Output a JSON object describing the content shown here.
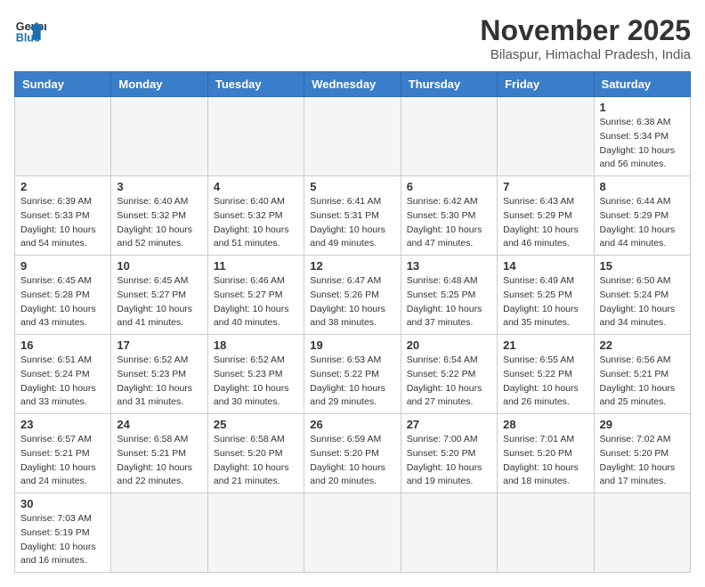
{
  "header": {
    "logo_line1": "General",
    "logo_line2": "Blue",
    "month": "November 2025",
    "location": "Bilaspur, Himachal Pradesh, India"
  },
  "weekdays": [
    "Sunday",
    "Monday",
    "Tuesday",
    "Wednesday",
    "Thursday",
    "Friday",
    "Saturday"
  ],
  "weeks": [
    [
      null,
      null,
      null,
      null,
      null,
      null,
      {
        "day": 1,
        "sunrise": "6:38 AM",
        "sunset": "5:34 PM",
        "daylight": "10 hours and 56 minutes."
      }
    ],
    [
      {
        "day": 2,
        "sunrise": "6:39 AM",
        "sunset": "5:33 PM",
        "daylight": "10 hours and 54 minutes."
      },
      {
        "day": 3,
        "sunrise": "6:40 AM",
        "sunset": "5:32 PM",
        "daylight": "10 hours and 52 minutes."
      },
      {
        "day": 4,
        "sunrise": "6:40 AM",
        "sunset": "5:32 PM",
        "daylight": "10 hours and 51 minutes."
      },
      {
        "day": 5,
        "sunrise": "6:41 AM",
        "sunset": "5:31 PM",
        "daylight": "10 hours and 49 minutes."
      },
      {
        "day": 6,
        "sunrise": "6:42 AM",
        "sunset": "5:30 PM",
        "daylight": "10 hours and 47 minutes."
      },
      {
        "day": 7,
        "sunrise": "6:43 AM",
        "sunset": "5:29 PM",
        "daylight": "10 hours and 46 minutes."
      },
      {
        "day": 8,
        "sunrise": "6:44 AM",
        "sunset": "5:29 PM",
        "daylight": "10 hours and 44 minutes."
      }
    ],
    [
      {
        "day": 9,
        "sunrise": "6:45 AM",
        "sunset": "5:28 PM",
        "daylight": "10 hours and 43 minutes."
      },
      {
        "day": 10,
        "sunrise": "6:45 AM",
        "sunset": "5:27 PM",
        "daylight": "10 hours and 41 minutes."
      },
      {
        "day": 11,
        "sunrise": "6:46 AM",
        "sunset": "5:27 PM",
        "daylight": "10 hours and 40 minutes."
      },
      {
        "day": 12,
        "sunrise": "6:47 AM",
        "sunset": "5:26 PM",
        "daylight": "10 hours and 38 minutes."
      },
      {
        "day": 13,
        "sunrise": "6:48 AM",
        "sunset": "5:25 PM",
        "daylight": "10 hours and 37 minutes."
      },
      {
        "day": 14,
        "sunrise": "6:49 AM",
        "sunset": "5:25 PM",
        "daylight": "10 hours and 35 minutes."
      },
      {
        "day": 15,
        "sunrise": "6:50 AM",
        "sunset": "5:24 PM",
        "daylight": "10 hours and 34 minutes."
      }
    ],
    [
      {
        "day": 16,
        "sunrise": "6:51 AM",
        "sunset": "5:24 PM",
        "daylight": "10 hours and 33 minutes."
      },
      {
        "day": 17,
        "sunrise": "6:52 AM",
        "sunset": "5:23 PM",
        "daylight": "10 hours and 31 minutes."
      },
      {
        "day": 18,
        "sunrise": "6:52 AM",
        "sunset": "5:23 PM",
        "daylight": "10 hours and 30 minutes."
      },
      {
        "day": 19,
        "sunrise": "6:53 AM",
        "sunset": "5:22 PM",
        "daylight": "10 hours and 29 minutes."
      },
      {
        "day": 20,
        "sunrise": "6:54 AM",
        "sunset": "5:22 PM",
        "daylight": "10 hours and 27 minutes."
      },
      {
        "day": 21,
        "sunrise": "6:55 AM",
        "sunset": "5:22 PM",
        "daylight": "10 hours and 26 minutes."
      },
      {
        "day": 22,
        "sunrise": "6:56 AM",
        "sunset": "5:21 PM",
        "daylight": "10 hours and 25 minutes."
      }
    ],
    [
      {
        "day": 23,
        "sunrise": "6:57 AM",
        "sunset": "5:21 PM",
        "daylight": "10 hours and 24 minutes."
      },
      {
        "day": 24,
        "sunrise": "6:58 AM",
        "sunset": "5:21 PM",
        "daylight": "10 hours and 22 minutes."
      },
      {
        "day": 25,
        "sunrise": "6:58 AM",
        "sunset": "5:20 PM",
        "daylight": "10 hours and 21 minutes."
      },
      {
        "day": 26,
        "sunrise": "6:59 AM",
        "sunset": "5:20 PM",
        "daylight": "10 hours and 20 minutes."
      },
      {
        "day": 27,
        "sunrise": "7:00 AM",
        "sunset": "5:20 PM",
        "daylight": "10 hours and 19 minutes."
      },
      {
        "day": 28,
        "sunrise": "7:01 AM",
        "sunset": "5:20 PM",
        "daylight": "10 hours and 18 minutes."
      },
      {
        "day": 29,
        "sunrise": "7:02 AM",
        "sunset": "5:20 PM",
        "daylight": "10 hours and 17 minutes."
      }
    ],
    [
      {
        "day": 30,
        "sunrise": "7:03 AM",
        "sunset": "5:19 PM",
        "daylight": "10 hours and 16 minutes."
      },
      null,
      null,
      null,
      null,
      null,
      null
    ]
  ]
}
